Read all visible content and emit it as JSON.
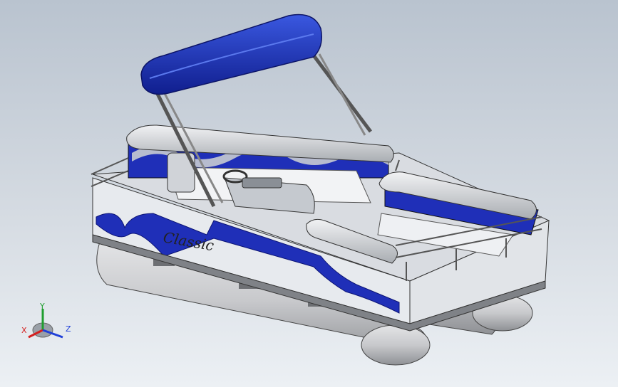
{
  "viewport": {
    "background_top": "#b9c3cf",
    "background_bottom": "#ecf0f4"
  },
  "model": {
    "hull_logo_text": "Classic",
    "colors": {
      "accent_blue": "#1f2fb8",
      "light_blue": "#3a58e0",
      "hull_white": "#e7eaee",
      "pontoon_gray": "#c8c9cc",
      "shadow_gray": "#8f9195"
    }
  },
  "triad": {
    "x_label": "X",
    "y_label": "Y",
    "z_label": "Z",
    "x_color": "#d42020",
    "y_color": "#1f9e2f",
    "z_color": "#2040d8"
  }
}
